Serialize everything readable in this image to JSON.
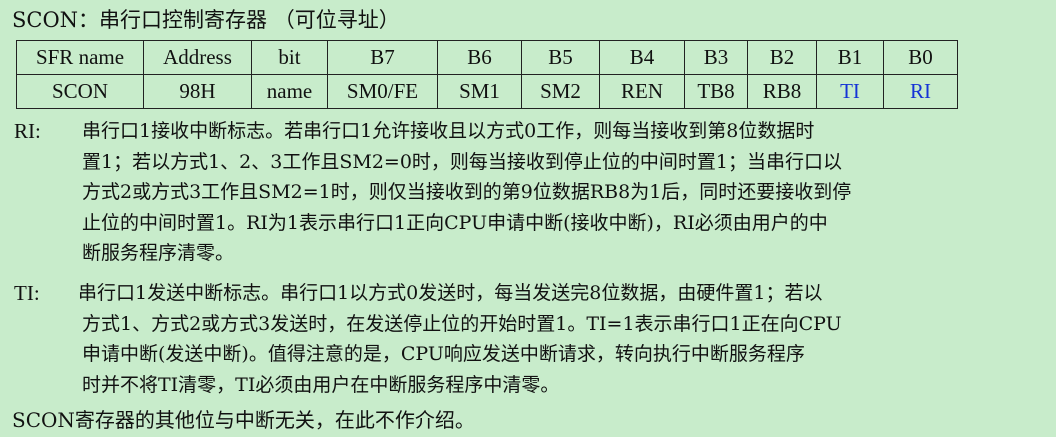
{
  "title": "SCON：串行口控制寄存器 （可位寻址）",
  "table": {
    "header": [
      "SFR name",
      "Address",
      "bit",
      "B7",
      "B6",
      "B5",
      "B4",
      "B3",
      "B2",
      "B1",
      "B0"
    ],
    "row": [
      "SCON",
      "98H",
      "name",
      "SM0/FE",
      "SM1",
      "SM2",
      "REN",
      "TB8",
      "RB8",
      "TI",
      "RI"
    ],
    "highlight_color": "#1533d6"
  },
  "ri": {
    "label": "RI:",
    "lines": [
      "串行口1接收中断标志。若串行口1允许接收且以方式0工作，则每当接收到第8位数据时",
      "置1；若以方式1、2、3工作且SM2=0时，则每当接收到停止位的中间时置1；当串行口以",
      "方式2或方式3工作且SM2=1时，则仅当接收到的第9位数据RB8为1后，同时还要接收到停",
      "止位的中间时置1。RI为1表示串行口1正向CPU申请中断(接收中断)，RI必须由用户的中",
      "断服务程序清零。"
    ]
  },
  "ti": {
    "label": "TI:",
    "lines": [
      "串行口1发送中断标志。串行口1以方式0发送时，每当发送完8位数据，由硬件置1；若以",
      "方式1、方式2或方式3发送时，在发送停止位的开始时置1。TI=1表示串行口1正在向CPU",
      "申请中断(发送中断)。值得注意的是，CPU响应发送中断请求，转向执行中断服务程序",
      "时并不将TI清零，TI必须由用户在中断服务程序中清零。"
    ]
  },
  "footer": "SCON寄存器的其他位与中断无关，在此不作介绍。",
  "colors": {
    "background": "#c8eccb",
    "text": "#111111",
    "bit_highlight": "#1533d6"
  }
}
